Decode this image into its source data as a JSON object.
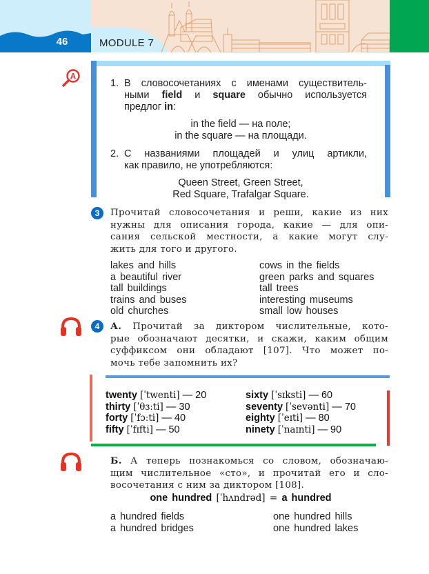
{
  "header": {
    "page_number": "46",
    "module_title": "MODULE 7",
    "colors": {
      "sky": "#cdeefa",
      "wave_blue": "#0a78c8",
      "beige": "#f6e3d4",
      "skyline": "#e0a070",
      "green_tab": "#00a651"
    }
  },
  "rule_box": {
    "icon": "magnifier-a-icon",
    "rule1": {
      "number": "1.",
      "line1": "В словосочетаниях с именами существитель-",
      "line2_pre": "ными ",
      "line2_bold1": "field",
      "line2_mid": " и ",
      "line2_bold2": "square",
      "line2_post": " обычно используется",
      "line3_pre": "предлог ",
      "line3_bold": "in",
      "line3_post": ":",
      "example1": "in the field — на поле;",
      "example2": "in the square — на площади."
    },
    "rule2": {
      "number": "2.",
      "line1": "С названиями площадей и улиц артикли,",
      "line2": "как правило, не употребляются:",
      "example1": "Queen Street, Green Street,",
      "example2": "Red Square, Trafalgar Square."
    }
  },
  "task3": {
    "number": "3",
    "instruction": [
      "Прочитай словосочетания и реши, какие из них",
      "нужны для описания города, какие — для опи-",
      "сания сельской местности, а какие могут слу-",
      "жить для того и другого."
    ],
    "phrases_left": [
      "lakes and hills",
      "a beautiful river",
      "tall buildings",
      "trains and buses",
      "old churches"
    ],
    "phrases_right": [
      "cows in the fields",
      "green parks and squares",
      "tall trees",
      "interesting museums",
      "small low houses"
    ]
  },
  "task4": {
    "number": "4",
    "icon": "headphones-icon",
    "part_a": {
      "label": "А.",
      "lines": [
        " Прочитай за диктором числительные, кото-",
        "рые обозначают десятки, и скажи, каким общим",
        "суффиксом они обладают [107]. Что может по-",
        "мочь тебе запомнить их?"
      ]
    },
    "numbers_left": [
      {
        "word": "twenty",
        "ipa": "[ˈtwenti]",
        "value": "— 20"
      },
      {
        "word": "thirty",
        "ipa": "[ˈθɜːti]",
        "value": "— 30"
      },
      {
        "word": "forty",
        "ipa": "[ˈfɔːti]",
        "value": "— 40"
      },
      {
        "word": "fifty",
        "ipa": "[ˈfɪfti]",
        "value": "— 50"
      }
    ],
    "numbers_right": [
      {
        "word": "sixty",
        "ipa": "[ˈsɪksti]",
        "value": "— 60"
      },
      {
        "word": "seventy",
        "ipa": "[ˈsevənti]",
        "value": "— 70"
      },
      {
        "word": "eighty",
        "ipa": "[ˈeɪti]",
        "value": "— 80"
      },
      {
        "word": "ninety",
        "ipa": "[ˈnaɪnti]",
        "value": "— 90"
      }
    ],
    "part_b": {
      "label": "Б.",
      "lines": [
        " А теперь познакомься со словом, обозначаю-",
        "щим числительное «сто», и прочитай его и сло-",
        "восочетания с ним за диктором [108]."
      ],
      "hundred_bold1": "one hundred",
      "hundred_ipa": " [ˈhʌndrəd] = ",
      "hundred_bold2": "a hundred"
    },
    "hundred_left": [
      "a hundred fields",
      "a hundred bridges"
    ],
    "hundred_right": [
      "one hundred hills",
      "one hundred lakes"
    ]
  }
}
